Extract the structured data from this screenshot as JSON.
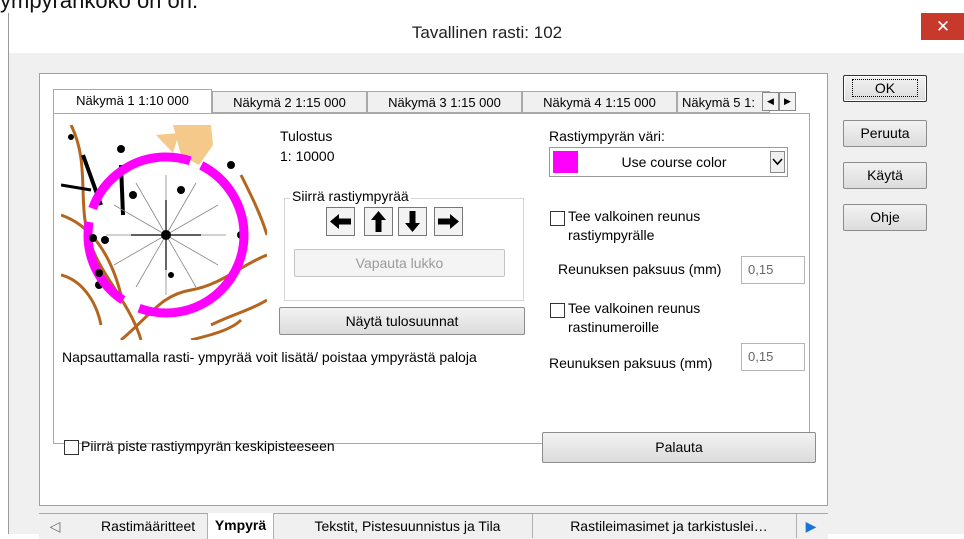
{
  "top_fragment": "ympyränkoko on on.",
  "window": {
    "title": "Tavallinen rasti: 102",
    "close_glyph": "✕"
  },
  "buttons": {
    "ok": "OK",
    "cancel": "Peruuta",
    "apply": "Käytä",
    "help": "Ohje"
  },
  "view_tabs": [
    {
      "label": "Näkymä 1 1:10 000",
      "active": true
    },
    {
      "label": "Näkymä 2 1:15 000",
      "active": false
    },
    {
      "label": "Näkymä 3 1:15 000",
      "active": false
    },
    {
      "label": "Näkymä 4 1:15 000",
      "active": false
    },
    {
      "label": "Näkymä 5 1:",
      "active": false
    }
  ],
  "preview": {
    "print_label": "Tulostus",
    "print_scale": "1: 10000",
    "move_group_label": "Siirrä rastiympyrää",
    "unlock_button": "Vapauta lukko",
    "show_print_directions_button": "Näytä tulosuunnat",
    "hint": "Napsauttamalla rasti- ympyrää voit lisätä/ poistaa ympyrästä paloja",
    "circle_color": "#ff00ff"
  },
  "color_setting": {
    "label": "Rastiympyrän väri:",
    "selected": "Use course color",
    "swatch": "#ff00ff"
  },
  "white_border_circle": {
    "checkbox_label_line1": "Tee valkoinen reunus",
    "checkbox_label_line2": "rastiympyrälle",
    "thickness_label": "Reunuksen paksuus (mm)",
    "thickness_value": "0,15",
    "checked": false
  },
  "white_border_numbers": {
    "checkbox_label_line1": "Tee valkoinen reunus",
    "checkbox_label_line2": "rastinumeroille",
    "thickness_label": "Reunuksen paksuus (mm)",
    "thickness_value": "0,15",
    "checked": false
  },
  "center_dot": {
    "label": "Piirrä piste rastiympyrän keskipisteeseen",
    "checked": false
  },
  "reset_button": "Palauta",
  "bottom_tabs": [
    {
      "label": "Rastimääritteet",
      "active": false
    },
    {
      "label": "Ympyrä",
      "active": true
    },
    {
      "label": "Tekstit, Pistesuunnistus ja Tila",
      "active": false
    },
    {
      "label": "Rastileimasimet ja tarkistuslei…",
      "active": false
    }
  ]
}
